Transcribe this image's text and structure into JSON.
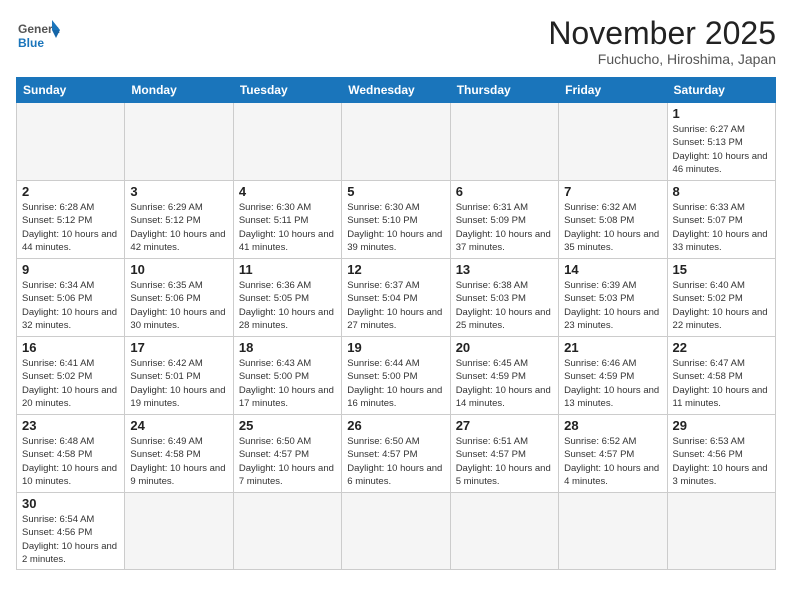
{
  "logo": {
    "text_general": "General",
    "text_blue": "Blue"
  },
  "title": "November 2025",
  "location": "Fuchucho, Hiroshima, Japan",
  "weekdays": [
    "Sunday",
    "Monday",
    "Tuesday",
    "Wednesday",
    "Thursday",
    "Friday",
    "Saturday"
  ],
  "weeks": [
    [
      {
        "day": "",
        "info": ""
      },
      {
        "day": "",
        "info": ""
      },
      {
        "day": "",
        "info": ""
      },
      {
        "day": "",
        "info": ""
      },
      {
        "day": "",
        "info": ""
      },
      {
        "day": "",
        "info": ""
      },
      {
        "day": "1",
        "info": "Sunrise: 6:27 AM\nSunset: 5:13 PM\nDaylight: 10 hours\nand 46 minutes."
      }
    ],
    [
      {
        "day": "2",
        "info": "Sunrise: 6:28 AM\nSunset: 5:12 PM\nDaylight: 10 hours\nand 44 minutes."
      },
      {
        "day": "3",
        "info": "Sunrise: 6:29 AM\nSunset: 5:12 PM\nDaylight: 10 hours\nand 42 minutes."
      },
      {
        "day": "4",
        "info": "Sunrise: 6:30 AM\nSunset: 5:11 PM\nDaylight: 10 hours\nand 41 minutes."
      },
      {
        "day": "5",
        "info": "Sunrise: 6:30 AM\nSunset: 5:10 PM\nDaylight: 10 hours\nand 39 minutes."
      },
      {
        "day": "6",
        "info": "Sunrise: 6:31 AM\nSunset: 5:09 PM\nDaylight: 10 hours\nand 37 minutes."
      },
      {
        "day": "7",
        "info": "Sunrise: 6:32 AM\nSunset: 5:08 PM\nDaylight: 10 hours\nand 35 minutes."
      },
      {
        "day": "8",
        "info": "Sunrise: 6:33 AM\nSunset: 5:07 PM\nDaylight: 10 hours\nand 33 minutes."
      }
    ],
    [
      {
        "day": "9",
        "info": "Sunrise: 6:34 AM\nSunset: 5:06 PM\nDaylight: 10 hours\nand 32 minutes."
      },
      {
        "day": "10",
        "info": "Sunrise: 6:35 AM\nSunset: 5:06 PM\nDaylight: 10 hours\nand 30 minutes."
      },
      {
        "day": "11",
        "info": "Sunrise: 6:36 AM\nSunset: 5:05 PM\nDaylight: 10 hours\nand 28 minutes."
      },
      {
        "day": "12",
        "info": "Sunrise: 6:37 AM\nSunset: 5:04 PM\nDaylight: 10 hours\nand 27 minutes."
      },
      {
        "day": "13",
        "info": "Sunrise: 6:38 AM\nSunset: 5:03 PM\nDaylight: 10 hours\nand 25 minutes."
      },
      {
        "day": "14",
        "info": "Sunrise: 6:39 AM\nSunset: 5:03 PM\nDaylight: 10 hours\nand 23 minutes."
      },
      {
        "day": "15",
        "info": "Sunrise: 6:40 AM\nSunset: 5:02 PM\nDaylight: 10 hours\nand 22 minutes."
      }
    ],
    [
      {
        "day": "16",
        "info": "Sunrise: 6:41 AM\nSunset: 5:02 PM\nDaylight: 10 hours\nand 20 minutes."
      },
      {
        "day": "17",
        "info": "Sunrise: 6:42 AM\nSunset: 5:01 PM\nDaylight: 10 hours\nand 19 minutes."
      },
      {
        "day": "18",
        "info": "Sunrise: 6:43 AM\nSunset: 5:00 PM\nDaylight: 10 hours\nand 17 minutes."
      },
      {
        "day": "19",
        "info": "Sunrise: 6:44 AM\nSunset: 5:00 PM\nDaylight: 10 hours\nand 16 minutes."
      },
      {
        "day": "20",
        "info": "Sunrise: 6:45 AM\nSunset: 4:59 PM\nDaylight: 10 hours\nand 14 minutes."
      },
      {
        "day": "21",
        "info": "Sunrise: 6:46 AM\nSunset: 4:59 PM\nDaylight: 10 hours\nand 13 minutes."
      },
      {
        "day": "22",
        "info": "Sunrise: 6:47 AM\nSunset: 4:58 PM\nDaylight: 10 hours\nand 11 minutes."
      }
    ],
    [
      {
        "day": "23",
        "info": "Sunrise: 6:48 AM\nSunset: 4:58 PM\nDaylight: 10 hours\nand 10 minutes."
      },
      {
        "day": "24",
        "info": "Sunrise: 6:49 AM\nSunset: 4:58 PM\nDaylight: 10 hours\nand 9 minutes."
      },
      {
        "day": "25",
        "info": "Sunrise: 6:50 AM\nSunset: 4:57 PM\nDaylight: 10 hours\nand 7 minutes."
      },
      {
        "day": "26",
        "info": "Sunrise: 6:50 AM\nSunset: 4:57 PM\nDaylight: 10 hours\nand 6 minutes."
      },
      {
        "day": "27",
        "info": "Sunrise: 6:51 AM\nSunset: 4:57 PM\nDaylight: 10 hours\nand 5 minutes."
      },
      {
        "day": "28",
        "info": "Sunrise: 6:52 AM\nSunset: 4:57 PM\nDaylight: 10 hours\nand 4 minutes."
      },
      {
        "day": "29",
        "info": "Sunrise: 6:53 AM\nSunset: 4:56 PM\nDaylight: 10 hours\nand 3 minutes."
      }
    ],
    [
      {
        "day": "30",
        "info": "Sunrise: 6:54 AM\nSunset: 4:56 PM\nDaylight: 10 hours\nand 2 minutes."
      },
      {
        "day": "",
        "info": ""
      },
      {
        "day": "",
        "info": ""
      },
      {
        "day": "",
        "info": ""
      },
      {
        "day": "",
        "info": ""
      },
      {
        "day": "",
        "info": ""
      },
      {
        "day": "",
        "info": ""
      }
    ]
  ]
}
